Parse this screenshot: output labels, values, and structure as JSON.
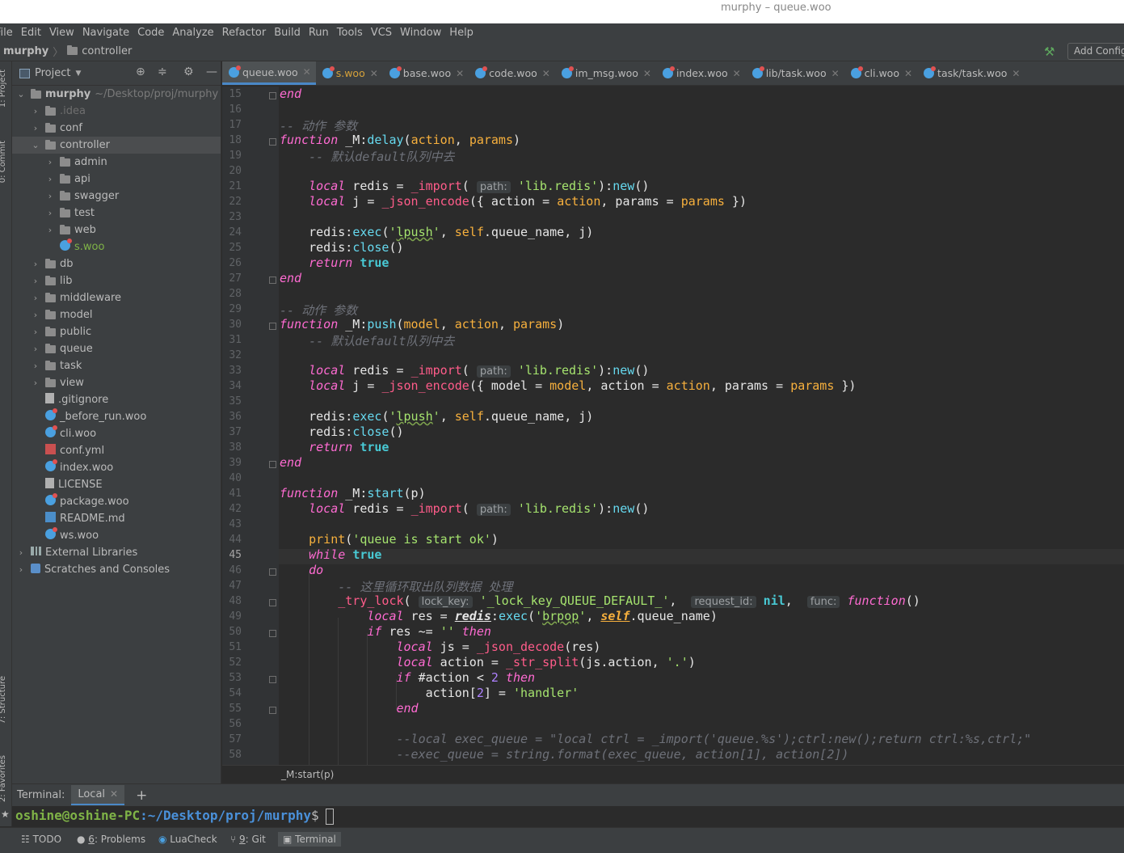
{
  "window": {
    "title": "murphy – queue.woo"
  },
  "menu": [
    "File",
    "Edit",
    "View",
    "Navigate",
    "Code",
    "Analyze",
    "Refactor",
    "Build",
    "Run",
    "Tools",
    "VCS",
    "Window",
    "Help"
  ],
  "navbar": {
    "project": "murphy",
    "folder": "controller",
    "add_config": "Add Config"
  },
  "side_tabs": {
    "project": "1: Project",
    "commit": "0: Commit",
    "structure": "7: Structure",
    "favorites": "2: Favorites"
  },
  "project_panel": {
    "title": "Project",
    "root": {
      "name": "murphy",
      "path": "~/Desktop/proj/murphy"
    },
    "items": [
      ".idea",
      "conf",
      "controller",
      "admin",
      "api",
      "swagger",
      "test",
      "web",
      "s.woo",
      "db",
      "lib",
      "middleware",
      "model",
      "public",
      "queue",
      "task",
      "view",
      ".gitignore",
      "_before_run.woo",
      "cli.woo",
      "conf.yml",
      "index.woo",
      "LICENSE",
      "package.woo",
      "README.md",
      "ws.woo",
      "External Libraries",
      "Scratches and Consoles"
    ]
  },
  "tabs": [
    "queue.woo",
    "s.woo",
    "base.woo",
    "code.woo",
    "im_msg.woo",
    "index.woo",
    "lib/task.woo",
    "cli.woo",
    "task/task.woo"
  ],
  "editor": {
    "line_numbers": [
      "15",
      "16",
      "17",
      "18",
      "19",
      "20",
      "21",
      "22",
      "23",
      "24",
      "25",
      "26",
      "27",
      "28",
      "29",
      "30",
      "31",
      "32",
      "33",
      "34",
      "35",
      "36",
      "37",
      "38",
      "39",
      "40",
      "41",
      "42",
      "43",
      "44",
      "45",
      "46",
      "47",
      "48",
      "49",
      "50",
      "51",
      "52",
      "53",
      "54",
      "55",
      "56",
      "57",
      "58"
    ],
    "current_line": "45",
    "hints": {
      "path": "path:",
      "lock_key": "lock_key:",
      "request_id": "request_id:",
      "func": "func:"
    },
    "breadcrumb": "_M:start(p)"
  },
  "terminal": {
    "label": "Terminal:",
    "tab": "Local",
    "prompt_user": "oshine@oshine-PC",
    "prompt_path": ":~/Desktop/proj/murphy",
    "prompt_sign": "$"
  },
  "statusbar": {
    "todo": "TODO",
    "problems": "Problems",
    "problems_key": "6",
    "luacheck": "LuaCheck",
    "git": "Git",
    "git_key": "9",
    "terminal": "Terminal"
  }
}
